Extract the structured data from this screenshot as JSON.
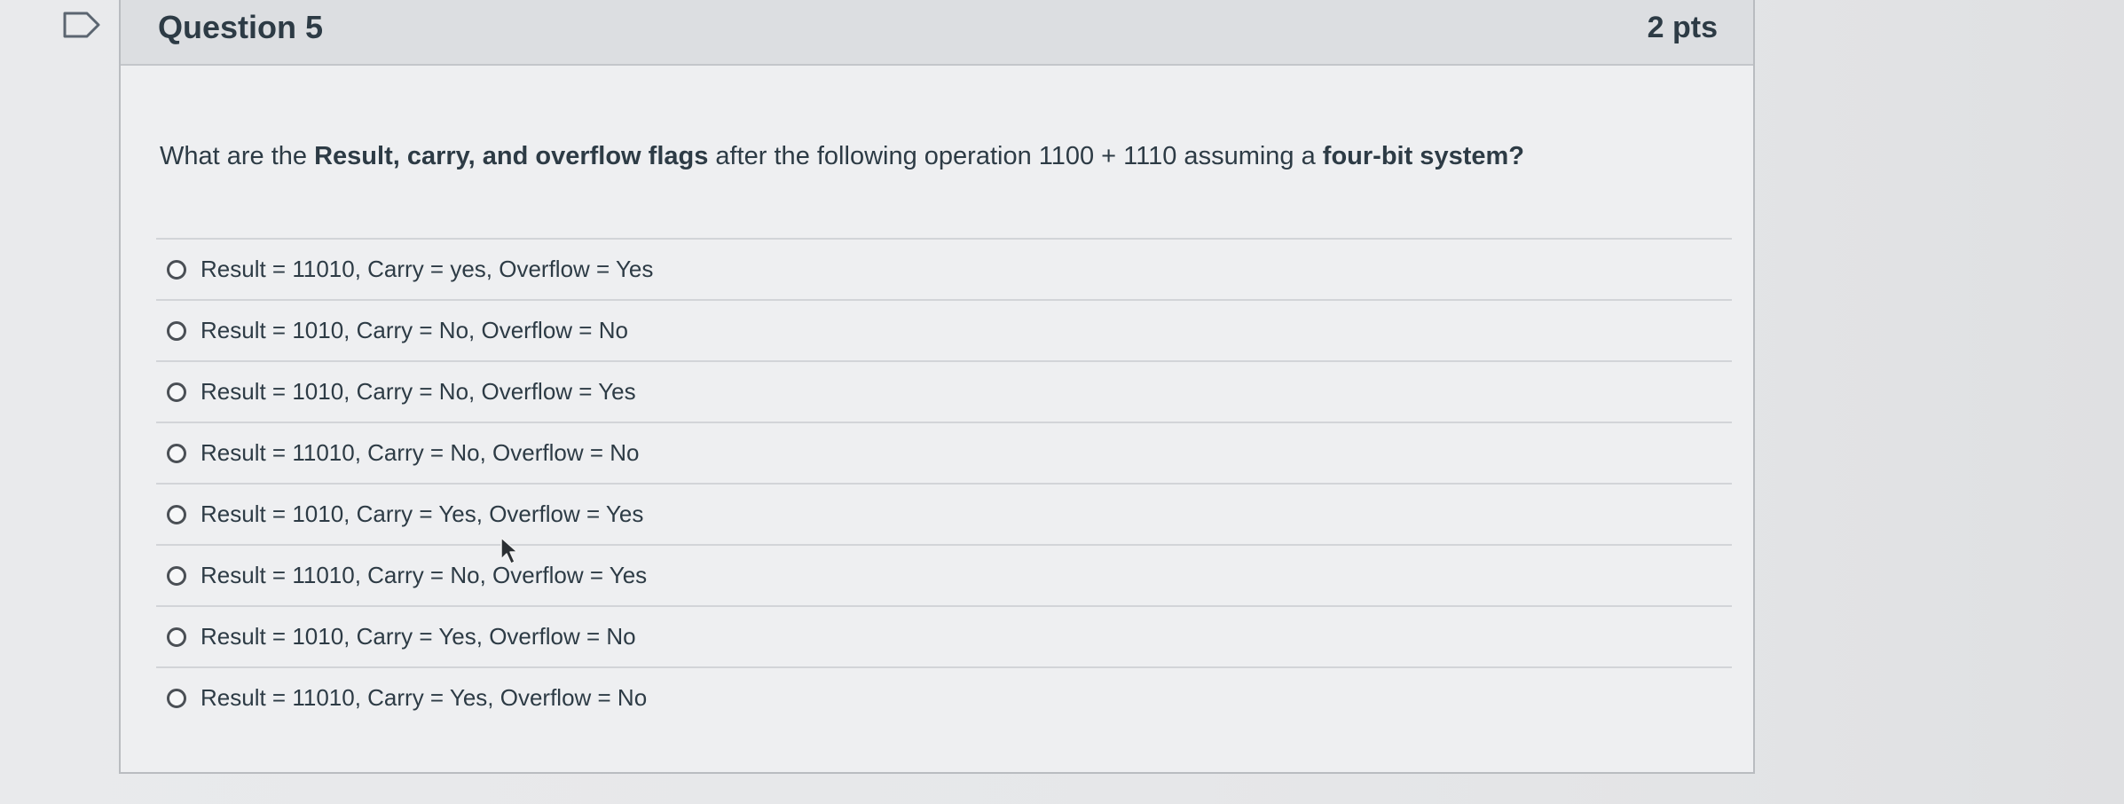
{
  "question": {
    "title": "Question 5",
    "points": "2 pts",
    "text_parts": [
      {
        "text": "What are the ",
        "bold": false
      },
      {
        "text": "Result, carry, and overflow flags",
        "bold": true
      },
      {
        "text": " after the following operation 1100 + 1110 assuming a ",
        "bold": false
      },
      {
        "text": "four-bit system?",
        "bold": true
      }
    ]
  },
  "answers": [
    {
      "label": "Result = 11010, Carry = yes, Overflow = Yes",
      "selected": false
    },
    {
      "label": "Result = 1010, Carry = No, Overflow = No",
      "selected": false
    },
    {
      "label": "Result = 1010, Carry = No, Overflow = Yes",
      "selected": false
    },
    {
      "label": "Result = 11010, Carry = No, Overflow = No",
      "selected": false
    },
    {
      "label": "Result = 1010, Carry = Yes, Overflow = Yes",
      "selected": false
    },
    {
      "label": "Result = 11010, Carry = No, Overflow = Yes",
      "selected": false
    },
    {
      "label": "Result = 1010, Carry = Yes, Overflow = No",
      "selected": false
    },
    {
      "label": "Result = 11010, Carry = Yes, Overflow = No",
      "selected": false
    }
  ],
  "icons": {
    "flag": "flag-question-icon",
    "cursor": "mouse-pointer-icon",
    "radio": "radio-button-icon"
  },
  "colors": {
    "text": "#2d3b45",
    "header_background": "#dcdee1",
    "card_background": "#eeeff1",
    "border": "#b9bcc0"
  }
}
